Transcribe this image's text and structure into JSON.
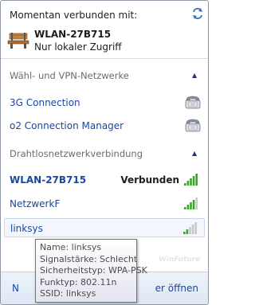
{
  "header": {
    "title": "Momentan verbunden mit:",
    "network_name": "WLAN-27B715",
    "network_status": "Nur lokaler Zugriff",
    "refresh_icon": "refresh-icon",
    "network_icon": "bench-icon"
  },
  "sections": {
    "dialup": {
      "label": "Wähl- und VPN-Netzwerke",
      "items": [
        {
          "label": "3G Connection",
          "icon": "dialup-phone-icon"
        },
        {
          "label": "o2 Connection Manager",
          "icon": "dialup-phone-icon"
        }
      ]
    },
    "wireless": {
      "label": "Drahtlosnetzwerkverbindung",
      "items": [
        {
          "label": "WLAN-27B715",
          "status": "Verbunden",
          "signal": 5
        },
        {
          "label": "NetzwerkF",
          "status": "",
          "signal": 4
        },
        {
          "label": "linksys",
          "status": "",
          "signal": 2
        }
      ]
    }
  },
  "tooltip": {
    "name": "Name: linksys",
    "signal": "Signalstärke: Schlecht",
    "security": "Sicherheitstyp: WPA-PSK",
    "radio": "Funktyp: 802.11n",
    "ssid": "SSID: linksys"
  },
  "footer": {
    "left_label": "N",
    "right_label": "er öffnen"
  },
  "watermark": "WinFuture",
  "colors": {
    "link": "#1a46a6",
    "signal_active": "#3aa62a",
    "signal_inactive": "#c8c8c8"
  }
}
